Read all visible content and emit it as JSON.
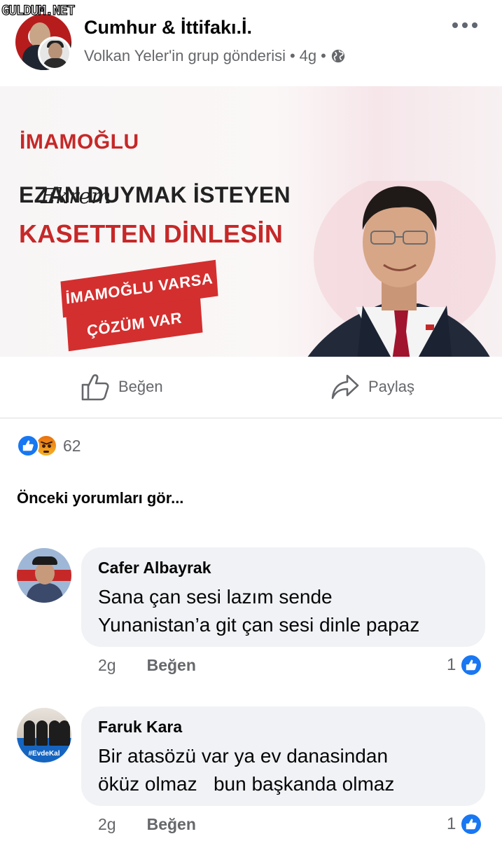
{
  "watermark": "GULDUM.NET",
  "post": {
    "group_name": "Cumhur & İttifakı.İ.",
    "subtitle": "Volkan Yeler'in grup gönderisi",
    "time": "4g",
    "separator": "•",
    "privacy_icon": "globe-icon",
    "more_icon": "more-horizontal-icon"
  },
  "image": {
    "signature": "Ekrem",
    "surname": "İMAMOĞLU",
    "headline_line1": "EZAN DUYMAK İSTEYEN",
    "headline_line2": "KASETTEN DİNLESİN",
    "ribbon_line1": "İMAMOĞLU VARSA",
    "ribbon_line2": "ÇÖZÜM VAR"
  },
  "actions": {
    "like_label": "Beğen",
    "share_label": "Paylaş"
  },
  "reactions": {
    "types": [
      "like",
      "angry"
    ],
    "count": "62"
  },
  "previous_comments_label": "Önceki yorumları gör...",
  "comments": [
    {
      "author": "Cafer Albayrak",
      "text_line1": "Sana çan sesi lazım sende",
      "text_line2": "Yunanistan’a git çan sesi dinle papaz",
      "time": "2g",
      "like_label": "Beğen",
      "like_count": "1"
    },
    {
      "author": "Faruk Kara",
      "text_line1": "Bir atasözü var ya ev danasindan",
      "text_line2": "öküz olmaz   bun başkanda olmaz",
      "time": "2g",
      "like_label": "Beğen",
      "like_count": "1",
      "avatar_tag": "#EvdeKal"
    }
  ],
  "colors": {
    "facebook_blue": "#1877f2",
    "secondary_text": "#65676b",
    "bubble_bg": "#f0f2f5",
    "poster_red": "#c62828"
  }
}
